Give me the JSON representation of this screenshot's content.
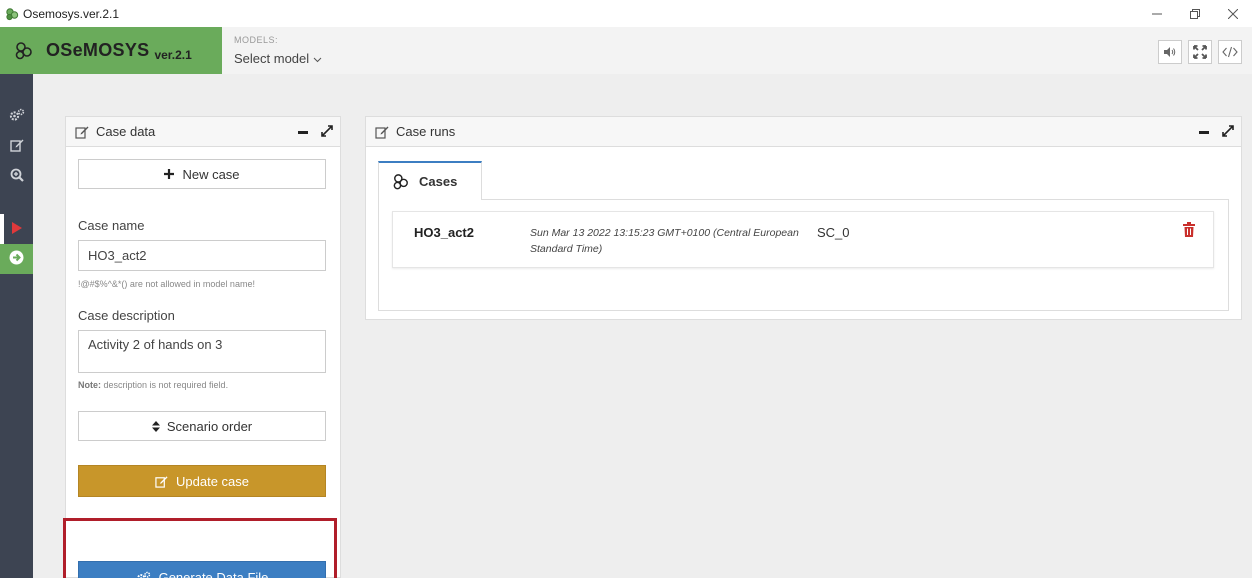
{
  "window": {
    "title": "Osemosys.ver.2.1"
  },
  "brand": {
    "name": "OSeMOSYS",
    "version": "ver.2.1",
    "color": "#6aab5b"
  },
  "models": {
    "label": "MODELS:",
    "selected": "Select model"
  },
  "header_buttons": [
    "speaker-icon",
    "expand-icon",
    "code-icon"
  ],
  "sidebar": {
    "items": [
      "gears-icon",
      "edit-icon",
      "zoom-in-icon",
      "play-icon",
      "arrow-right-circle-icon"
    ],
    "active": "play-icon"
  },
  "case_data": {
    "title": "Case data",
    "new_case_label": "New case",
    "case_name_label": "Case name",
    "case_name_value": "HO3_act2",
    "case_name_hint": "!@#$%^&*() are not allowed in model name!",
    "case_description_label": "Case description",
    "case_description_value": "Activity 2 of hands on 3",
    "note_bold": "Note:",
    "note_text": " description is not required field.",
    "scenario_order_label": "Scenario order",
    "update_case_label": "Update case",
    "generate_label": "Generate Data File"
  },
  "case_runs": {
    "title": "Case runs",
    "tab_label": "Cases",
    "runs": [
      {
        "name": "HO3_act2",
        "date": "Sun Mar 13 2022 13:15:23 GMT+0100 (Central European Standard Time)",
        "scenario": "SC_0"
      }
    ]
  },
  "colors": {
    "sidebar": "#3d4452",
    "update": "#c8962a",
    "generate": "#3c7ec2",
    "highlight": "#b01e2a",
    "delete": "#c9302c"
  }
}
